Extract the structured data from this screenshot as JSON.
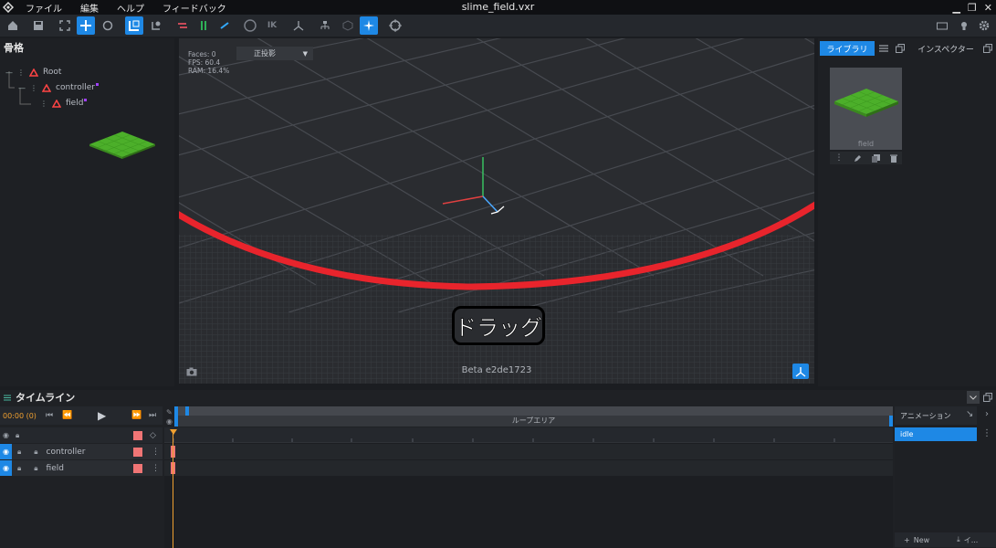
{
  "app": {
    "menu": [
      "ファイル",
      "編集",
      "ヘルプ",
      "フィードバック"
    ],
    "file_title": "slime_field.vxr"
  },
  "left_panel": {
    "title": "骨格",
    "tree": [
      {
        "label": "Root",
        "depth": 0
      },
      {
        "label": "controller",
        "depth": 1
      },
      {
        "label": "field",
        "depth": 2
      }
    ]
  },
  "viewport": {
    "stats": [
      "Faces: 0",
      "FPS: 60.4",
      "RAM: 16.4%"
    ],
    "projection": "正投影",
    "version": "Beta e2de1723",
    "annotation": "ドラッグ",
    "accent": "#e8242c"
  },
  "right_panel": {
    "tab_library": "ライブラリ",
    "tab_inspector": "インスペクター",
    "asset_name": "field"
  },
  "timeline": {
    "title": "タイムライン",
    "time": "00:00 (0)",
    "loop_label": "ループエリア",
    "tracks": [
      "controller",
      "field"
    ],
    "animation_header": "アニメーション",
    "animations": [
      "idle"
    ],
    "new_label": "New",
    "import_label": "イ..."
  },
  "colors": {
    "accent": "#1e88e5",
    "keyframe": "#f07575",
    "playhead": "#f0a030"
  }
}
